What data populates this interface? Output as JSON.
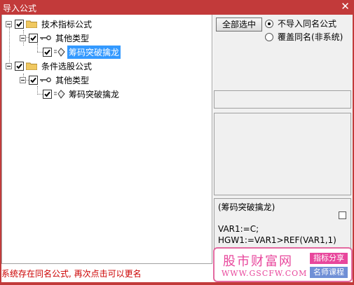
{
  "window": {
    "title": "导入公式",
    "close_label": "✕"
  },
  "tree": {
    "nodes": [
      {
        "label": "技术指标公式",
        "type": "folder"
      },
      {
        "label": "其他类型",
        "type": "key"
      },
      {
        "label": "筹码突破擒龙",
        "type": "formula",
        "selected": true
      },
      {
        "label": "条件选股公式",
        "type": "folder"
      },
      {
        "label": "其他类型",
        "type": "key"
      },
      {
        "label": "筹码突破擒龙",
        "type": "formula",
        "selected": false
      }
    ]
  },
  "options": {
    "select_all_label": "全部选中",
    "radio_no_import": "不导入同名公式",
    "radio_overwrite": "覆盖同名(非系统)",
    "selected": "no_import"
  },
  "preview": {
    "name": "(筹码突破擒龙)",
    "line1": "VAR1:=C;",
    "line2": "HGW1:=VAR1>REF(VAR1,1)"
  },
  "status_text": "系统存在同名公式, 再次点击可以更名",
  "watermark": {
    "site": "股市财富网",
    "url": "WWW.GSCFW.COM",
    "tag1": "指标分享",
    "tag2": "名师课程"
  },
  "colors": {
    "titlebar": "#c23a3a",
    "selection": "#3399ff",
    "status": "#cc0000",
    "watermark": "#e8479c"
  }
}
